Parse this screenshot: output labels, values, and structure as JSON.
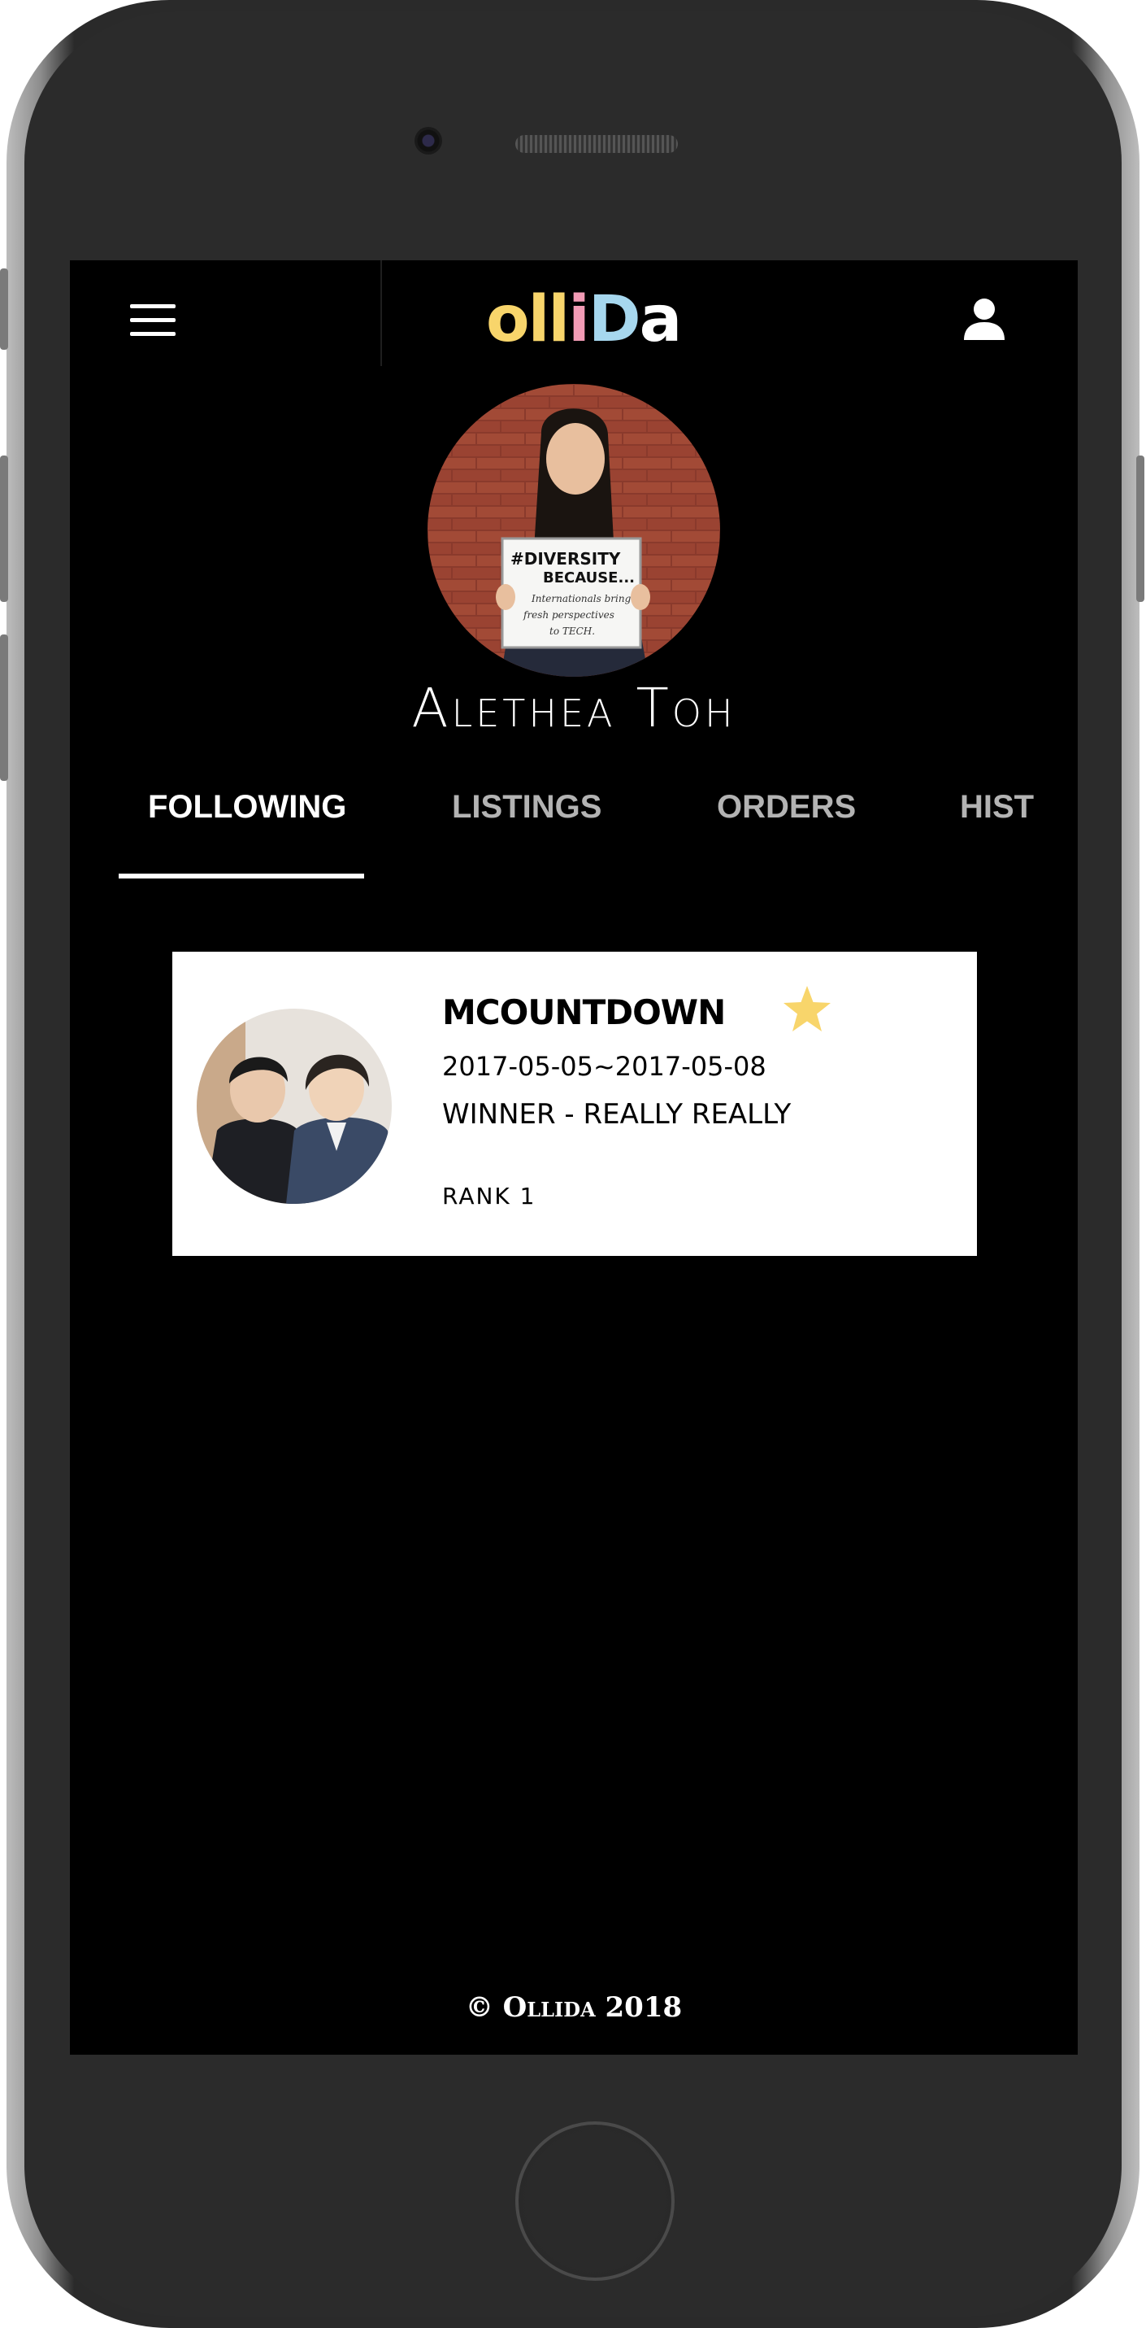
{
  "app": {
    "logo_letters": [
      "o",
      "l",
      "l",
      "i",
      "D",
      "a"
    ],
    "brand_colors": {
      "yellow": "#f8d56b",
      "pink": "#f29bb5",
      "blue": "#a6d7ee",
      "white": "#ffffff"
    }
  },
  "header": {
    "menu_icon": "hamburger-menu-icon",
    "account_icon": "user-icon"
  },
  "profile": {
    "name": "Alethea Toh",
    "sign_line1": "#DIVERSITY",
    "sign_line2": "BECAUSE...",
    "sign_line3": "Internationals bring",
    "sign_line4": "fresh perspectives",
    "sign_line5": "to TECH."
  },
  "tabs": [
    {
      "label": "FOLLOWING",
      "active": true
    },
    {
      "label": "LISTINGS",
      "active": false
    },
    {
      "label": "ORDERS",
      "active": false
    },
    {
      "label": "HIST",
      "active": false
    }
  ],
  "following": [
    {
      "title": "MCOUNTDOWN",
      "dates": "2017-05-05~2017-05-08",
      "song": "WINNER - REALLY REALLY",
      "rank": "RANK 1",
      "starred": true,
      "star_color": "#f8d56b"
    }
  ],
  "footer": {
    "text": "© Ollida 2018"
  }
}
